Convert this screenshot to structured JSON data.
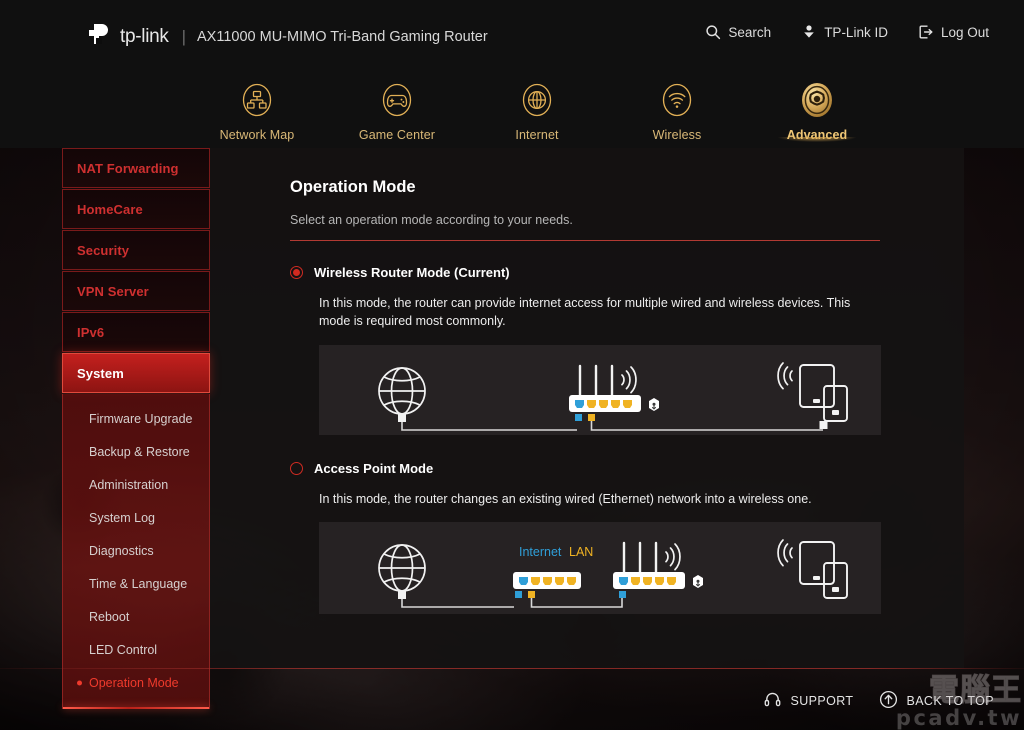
{
  "header": {
    "brand": "tp-link",
    "divider": "|",
    "model": "AX11000 MU-MIMO Tri-Band Gaming Router",
    "actions": [
      {
        "label": "Search",
        "icon": "search-icon"
      },
      {
        "label": "TP-Link ID",
        "icon": "tplink-id-icon"
      },
      {
        "label": "Log Out",
        "icon": "logout-icon"
      }
    ]
  },
  "mainnav": {
    "items": [
      {
        "label": "Network Map",
        "icon": "network-map-icon",
        "active": false
      },
      {
        "label": "Game Center",
        "icon": "gamepad-icon",
        "active": false
      },
      {
        "label": "Internet",
        "icon": "globe-icon",
        "active": false
      },
      {
        "label": "Wireless",
        "icon": "wifi-icon",
        "active": false
      },
      {
        "label": "Advanced",
        "icon": "gear-icon",
        "active": true
      }
    ]
  },
  "sidebar": {
    "items": [
      {
        "label": "NAT Forwarding",
        "active": false
      },
      {
        "label": "HomeCare",
        "active": false
      },
      {
        "label": "Security",
        "active": false
      },
      {
        "label": "VPN Server",
        "active": false
      },
      {
        "label": "IPv6",
        "active": false
      },
      {
        "label": "System",
        "active": true
      }
    ],
    "submenu": [
      {
        "label": "Firmware Upgrade",
        "active": false
      },
      {
        "label": "Backup & Restore",
        "active": false
      },
      {
        "label": "Administration",
        "active": false
      },
      {
        "label": "System Log",
        "active": false
      },
      {
        "label": "Diagnostics",
        "active": false
      },
      {
        "label": "Time & Language",
        "active": false
      },
      {
        "label": "Reboot",
        "active": false
      },
      {
        "label": "LED Control",
        "active": false
      },
      {
        "label": "Operation Mode",
        "active": true
      }
    ]
  },
  "main": {
    "title": "Operation Mode",
    "subtitle": "Select an operation mode according to your needs.",
    "modes": [
      {
        "id": "wireless-router-mode",
        "title": "Wireless Router Mode (Current)",
        "selected": true,
        "description": "In this mode, the router can provide internet access for multiple wired and wireless devices. This mode is required most commonly."
      },
      {
        "id": "access-point-mode",
        "title": "Access Point Mode",
        "selected": false,
        "description": "In this mode, the router changes an existing wired (Ethernet) network into a wireless one."
      }
    ],
    "diagram_labels": {
      "internet": "Internet",
      "lan": "LAN"
    }
  },
  "footer": {
    "items": [
      {
        "label": "SUPPORT",
        "icon": "headset-icon"
      },
      {
        "label": "BACK TO TOP",
        "icon": "arrow-up-circle-icon"
      }
    ]
  },
  "watermark": {
    "cn": "電腦王",
    "en": "pcadv.tw"
  },
  "colors": {
    "gold": "#e2b056",
    "brand_red": "#cf2b22",
    "wan_blue": "#2f9fd8",
    "lan_yellow": "#f0b323",
    "panel_bg": "#141212",
    "diagram_bg": "#262223"
  }
}
